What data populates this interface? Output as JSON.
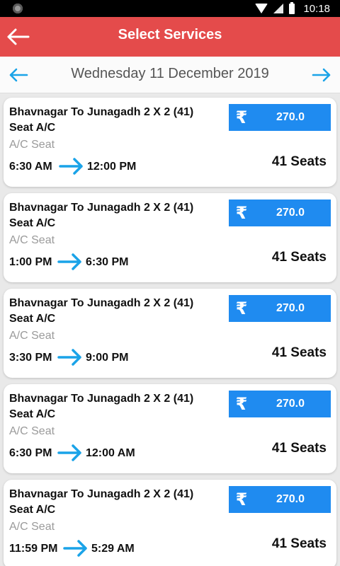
{
  "status_bar": {
    "time": "10:18"
  },
  "header": {
    "title": "Select Services"
  },
  "date_nav": {
    "date": "Wednesday 11 December 2019"
  },
  "services": [
    {
      "route": "Bhavnagar To Junagadh 2 X 2 (41) Seat A/C",
      "seat_type": "A/C Seat",
      "departure": "6:30 AM",
      "arrival": "12:00 PM",
      "currency": "₹",
      "price": "270.0",
      "seats": "41 Seats"
    },
    {
      "route": "Bhavnagar To Junagadh 2 X 2 (41) Seat A/C",
      "seat_type": "A/C Seat",
      "departure": "1:00 PM",
      "arrival": "6:30 PM",
      "currency": "₹",
      "price": "270.0",
      "seats": "41 Seats"
    },
    {
      "route": "Bhavnagar To Junagadh 2 X 2 (41) Seat A/C",
      "seat_type": "A/C Seat",
      "departure": "3:30 PM",
      "arrival": "9:00 PM",
      "currency": "₹",
      "price": "270.0",
      "seats": "41 Seats"
    },
    {
      "route": "Bhavnagar To Junagadh 2 X 2 (41) Seat A/C",
      "seat_type": "A/C Seat",
      "departure": "6:30 PM",
      "arrival": "12:00 AM",
      "currency": "₹",
      "price": "270.0",
      "seats": "41 Seats"
    },
    {
      "route": "Bhavnagar To Junagadh 2 X 2 (41) Seat A/C",
      "seat_type": "A/C Seat",
      "departure": "11:59 PM",
      "arrival": "5:29 AM",
      "currency": "₹",
      "price": "270.0",
      "seats": "41 Seats"
    }
  ],
  "colors": {
    "app_bar": "#e44b4b",
    "price_bg": "#1f8bf0",
    "arrow": "#1aa3e8"
  }
}
